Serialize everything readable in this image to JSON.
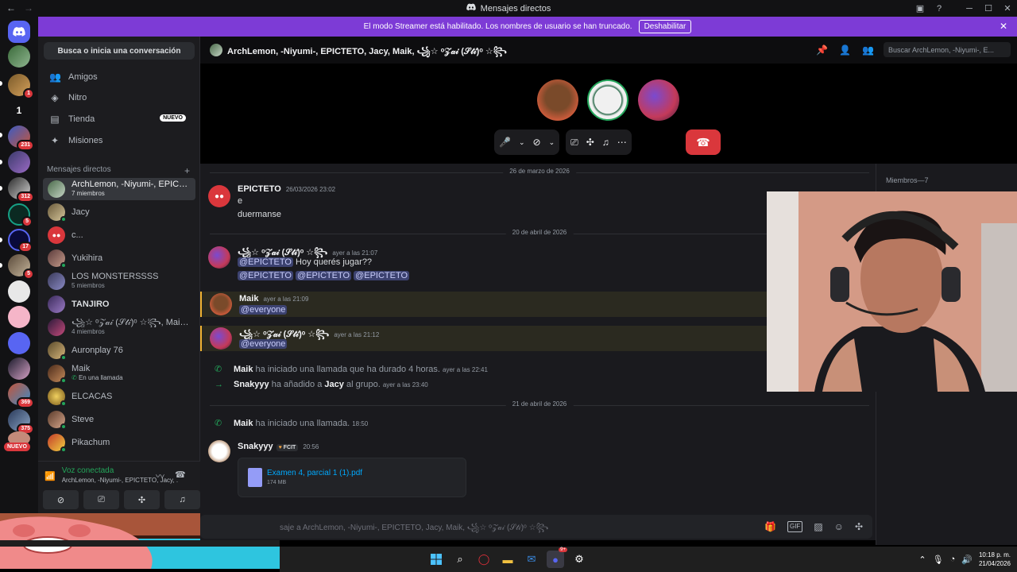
{
  "window": {
    "title": "Mensajes directos",
    "icons": [
      "back-arrow-icon",
      "forward-arrow-icon",
      "discord-icon",
      "inbox-icon",
      "help-icon",
      "minimize-icon",
      "maximize-icon",
      "close-icon"
    ]
  },
  "banner": {
    "text": "El modo Streamer está habilitado. Los nombres de usuario se han truncado.",
    "button": "Deshabilitar"
  },
  "rail": {
    "badges": [
      "1",
      "1",
      "231",
      "5",
      "312",
      "5",
      "17",
      "5",
      "369",
      "375"
    ],
    "new_label": "NUEVO"
  },
  "sidebar": {
    "search_placeholder": "Busca o inicia una conversación",
    "nav": [
      {
        "label": "Amigos",
        "icon": "friends-icon"
      },
      {
        "label": "Nitro",
        "icon": "nitro-icon"
      },
      {
        "label": "Tienda",
        "icon": "shop-icon",
        "badge": "NUEVO"
      },
      {
        "label": "Misiones",
        "icon": "quests-icon"
      }
    ],
    "dm_header": "Mensajes directos",
    "dms": [
      {
        "name": "ArchLemon, -Niyumi-, EPICTETO...",
        "sub": "7 miembros"
      },
      {
        "name": "Jacy",
        "sub": ""
      },
      {
        "name": "c...",
        "sub": ""
      },
      {
        "name": "Yukihira",
        "sub": ""
      },
      {
        "name": "LOS MONSTERSSSS",
        "sub": "5 miembros"
      },
      {
        "name": "TANJIRO",
        "sub": ""
      },
      {
        "name": "꧁☆ ᵒ𝒵𝒶𝒾 (𝒮𝓉𝒾)ᵒ ☆꧂, Maik, Arc...",
        "sub": "4 miembros"
      },
      {
        "name": "Auronplay 76",
        "sub": ""
      },
      {
        "name": "Maik",
        "sub": "En una llamada"
      },
      {
        "name": "ELCACAS",
        "sub": ""
      },
      {
        "name": "Steve",
        "sub": ""
      },
      {
        "name": "Pikachum",
        "sub": ""
      }
    ]
  },
  "voice": {
    "status": "Voz conectada",
    "channel": "ArchLemon, -Niyumi-, EPICTETO, Jacy, ..."
  },
  "header": {
    "title": "ArchLemon, -Niyumi-, EPICTETO, Jacy, Maik, ꧁☆ ᵒ𝒵𝒶𝒾 (𝒮𝓉𝒾)ᵒ ☆꧂",
    "search_placeholder": "Buscar ArchLemon, -Niyumi-, E..."
  },
  "messages": {
    "date1": "26 de marzo de 2026",
    "m1": {
      "author": "EPICTETO",
      "time": "26/03/2026 23:02",
      "lines": [
        "e",
        "duermanse"
      ]
    },
    "date2": "20 de abril de 2026",
    "m2": {
      "author": "꧁☆ ᵒ𝒵𝒶𝒾 (𝒮𝓉𝒾)ᵒ ☆꧂",
      "time": "ayer a las 21:07",
      "mention": "@EPICTETO",
      "text": "Hoy querés jugar??",
      "line2": [
        "@EPICTETO",
        "@EPICTETO",
        "@EPICTETO"
      ]
    },
    "m3": {
      "author": "Maik",
      "time": "ayer a las 21:09",
      "mention": "@everyone"
    },
    "m4": {
      "author": "꧁☆ ᵒ𝒵𝒶𝒾 (𝒮𝓉𝒾)ᵒ ☆꧂",
      "time": "ayer a las 21:12",
      "mention": "@everyone"
    },
    "sys1": {
      "who": "Maik",
      "text": "ha iniciado una llamada que ha durado 4 horas.",
      "time": "ayer a las 22:41"
    },
    "sys2": {
      "who": "Snakyyy",
      "text": "ha añadido a",
      "target": "Jacy",
      "text2": "al grupo.",
      "time": "ayer a las 23:40"
    },
    "date3": "21 de abril de 2026",
    "sys3": {
      "who": "Maik",
      "text": "ha iniciado una llamada.",
      "time": "18:50"
    },
    "m5": {
      "author": "Snakyyy",
      "tag": "FCIT",
      "time": "20:56",
      "file_name": "Examen 4, parcial 1 (1).pdf",
      "file_size": "174 MB"
    }
  },
  "members": {
    "header": "Miembros—7"
  },
  "input": {
    "placeholder": "saje a ArchLemon, -Niyumi-, EPICTETO, Jacy, Maik, ꧁☆ ᵒ𝒵𝒶𝒾 (𝒮𝓉𝒾)ᵒ ☆꧂"
  },
  "taskbar": {
    "time": "10:18 p. m.",
    "date": "21/04/2026",
    "discord_badge": "9+"
  },
  "colors": {
    "accent": "#5865f2",
    "banner": "#7d3bd6",
    "online": "#23a55a",
    "danger": "#da373c",
    "mention_bg": "#3c4270"
  }
}
